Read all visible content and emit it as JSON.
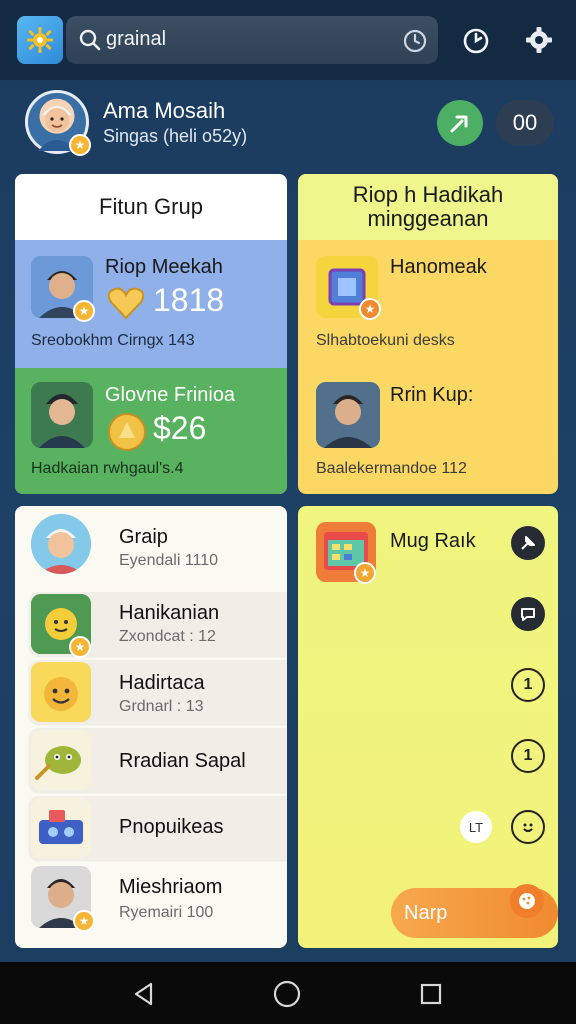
{
  "search": {
    "query": "grainal"
  },
  "profile": {
    "name": "Ama Mosaih",
    "subtitle": "Singas (heli o52y)",
    "count": "00"
  },
  "feature_card": {
    "title": "Fitun Grup",
    "item1": {
      "title": "Riop Meekah",
      "amount": "1818",
      "caption": "Sreobokhm Cirngx 143"
    },
    "item2": {
      "title": "Glovne Frinioa",
      "amount": "$26",
      "caption": "Hadkaian rwhgaul's.4"
    }
  },
  "weekly_card": {
    "title": "Riop h Hadikah minggeanan",
    "item1": {
      "title": "Hanomeak",
      "caption": "Slhabtoekuni desks"
    },
    "item2": {
      "title": "Rrin Kup:",
      "caption": "Baalekermandoe 112"
    }
  },
  "list": [
    {
      "title": "Graip",
      "sub": "Eyendali 1110"
    },
    {
      "title": "Hanikanian",
      "sub": "Zxondcat : 12"
    },
    {
      "title": "Hadirtaca",
      "sub": "Grdnarl : 13"
    },
    {
      "title": "Rradian Sapal",
      "sub": ""
    },
    {
      "title": "Pnopuikeas",
      "sub": ""
    },
    {
      "title": "Mieshriaom",
      "sub": "Ryemairi 100"
    }
  ],
  "rank_card": {
    "title": "Mug Raık",
    "mini_badge": "LT",
    "cta_label": "Narp"
  },
  "icons": {
    "app": "sun-gear-icon",
    "search": "search-icon",
    "clock": "history-icon",
    "timer": "timer-icon",
    "settings": "gear-icon",
    "share": "share-arrow-icon",
    "nav_back": "back-triangle-icon",
    "nav_home": "home-circle-icon",
    "nav_recent": "recent-square-icon"
  },
  "colors": {
    "topbar": "#142a42",
    "blue_block": "#8fb0e8",
    "green_block": "#58b25f",
    "yellow_card": "#fbd863",
    "cta": "#f08a2f"
  }
}
